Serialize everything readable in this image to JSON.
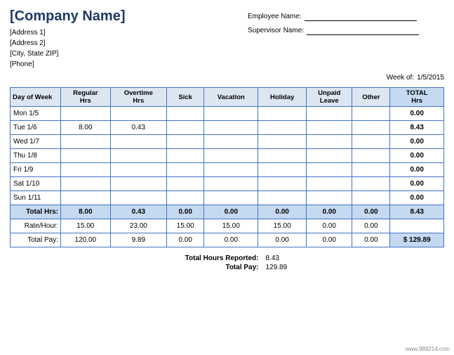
{
  "company": {
    "name": "[Company Name]",
    "address1": "[Address 1]",
    "address2": "[Address 2]",
    "cityStateZip": "[City, State  ZIP]",
    "phone": "[Phone]"
  },
  "employee": {
    "name_label": "Employee Name:",
    "supervisor_label": "Supervisor Name:",
    "week_label": "Week of:",
    "week_value": "1/5/2015"
  },
  "table": {
    "headers": [
      "Day of Week",
      "Regular Hrs",
      "Overtime Hrs",
      "Sick",
      "Vacation",
      "Holiday",
      "Unpaid Leave",
      "Other",
      "TOTAL Hrs"
    ],
    "rows": [
      {
        "day": "Mon 1/5",
        "regular": "",
        "overtime": "",
        "sick": "",
        "vacation": "",
        "holiday": "",
        "unpaid": "",
        "other": "",
        "total": "0.00"
      },
      {
        "day": "Tue 1/6",
        "regular": "8.00",
        "overtime": "0.43",
        "sick": "",
        "vacation": "",
        "holiday": "",
        "unpaid": "",
        "other": "",
        "total": "8.43"
      },
      {
        "day": "Wed 1/7",
        "regular": "",
        "overtime": "",
        "sick": "",
        "vacation": "",
        "holiday": "",
        "unpaid": "",
        "other": "",
        "total": "0.00"
      },
      {
        "day": "Thu 1/8",
        "regular": "",
        "overtime": "",
        "sick": "",
        "vacation": "",
        "holiday": "",
        "unpaid": "",
        "other": "",
        "total": "0.00"
      },
      {
        "day": "Fri 1/9",
        "regular": "",
        "overtime": "",
        "sick": "",
        "vacation": "",
        "holiday": "",
        "unpaid": "",
        "other": "",
        "total": "0.00"
      },
      {
        "day": "Sat 1/10",
        "regular": "",
        "overtime": "",
        "sick": "",
        "vacation": "",
        "holiday": "",
        "unpaid": "",
        "other": "",
        "total": "0.00"
      },
      {
        "day": "Sun 1/11",
        "regular": "",
        "overtime": "",
        "sick": "",
        "vacation": "",
        "holiday": "",
        "unpaid": "",
        "other": "",
        "total": "0.00"
      }
    ],
    "total_hrs": {
      "label": "Total Hrs:",
      "regular": "8.00",
      "overtime": "0.43",
      "sick": "0.00",
      "vacation": "0.00",
      "holiday": "0.00",
      "unpaid": "0.00",
      "other": "0.00",
      "total": "8.43"
    },
    "rate": {
      "label": "Rate/Hour:",
      "regular": "15.00",
      "overtime": "23.00",
      "sick": "15.00",
      "vacation": "15.00",
      "holiday": "15.00",
      "unpaid": "0.00",
      "other": "0.00",
      "total": ""
    },
    "total_pay": {
      "label": "Total Pay:",
      "regular": "120.00",
      "overtime": "9.89",
      "sick": "0.00",
      "vacation": "0.00",
      "holiday": "0.00",
      "unpaid": "0.00",
      "other": "0.00",
      "total": "$ 129.89"
    }
  },
  "summary": {
    "hours_label": "Total Hours Reported:",
    "hours_value": "8.43",
    "pay_label": "Total Pay:",
    "pay_value": "129.89"
  },
  "watermark": "www.989214.com"
}
